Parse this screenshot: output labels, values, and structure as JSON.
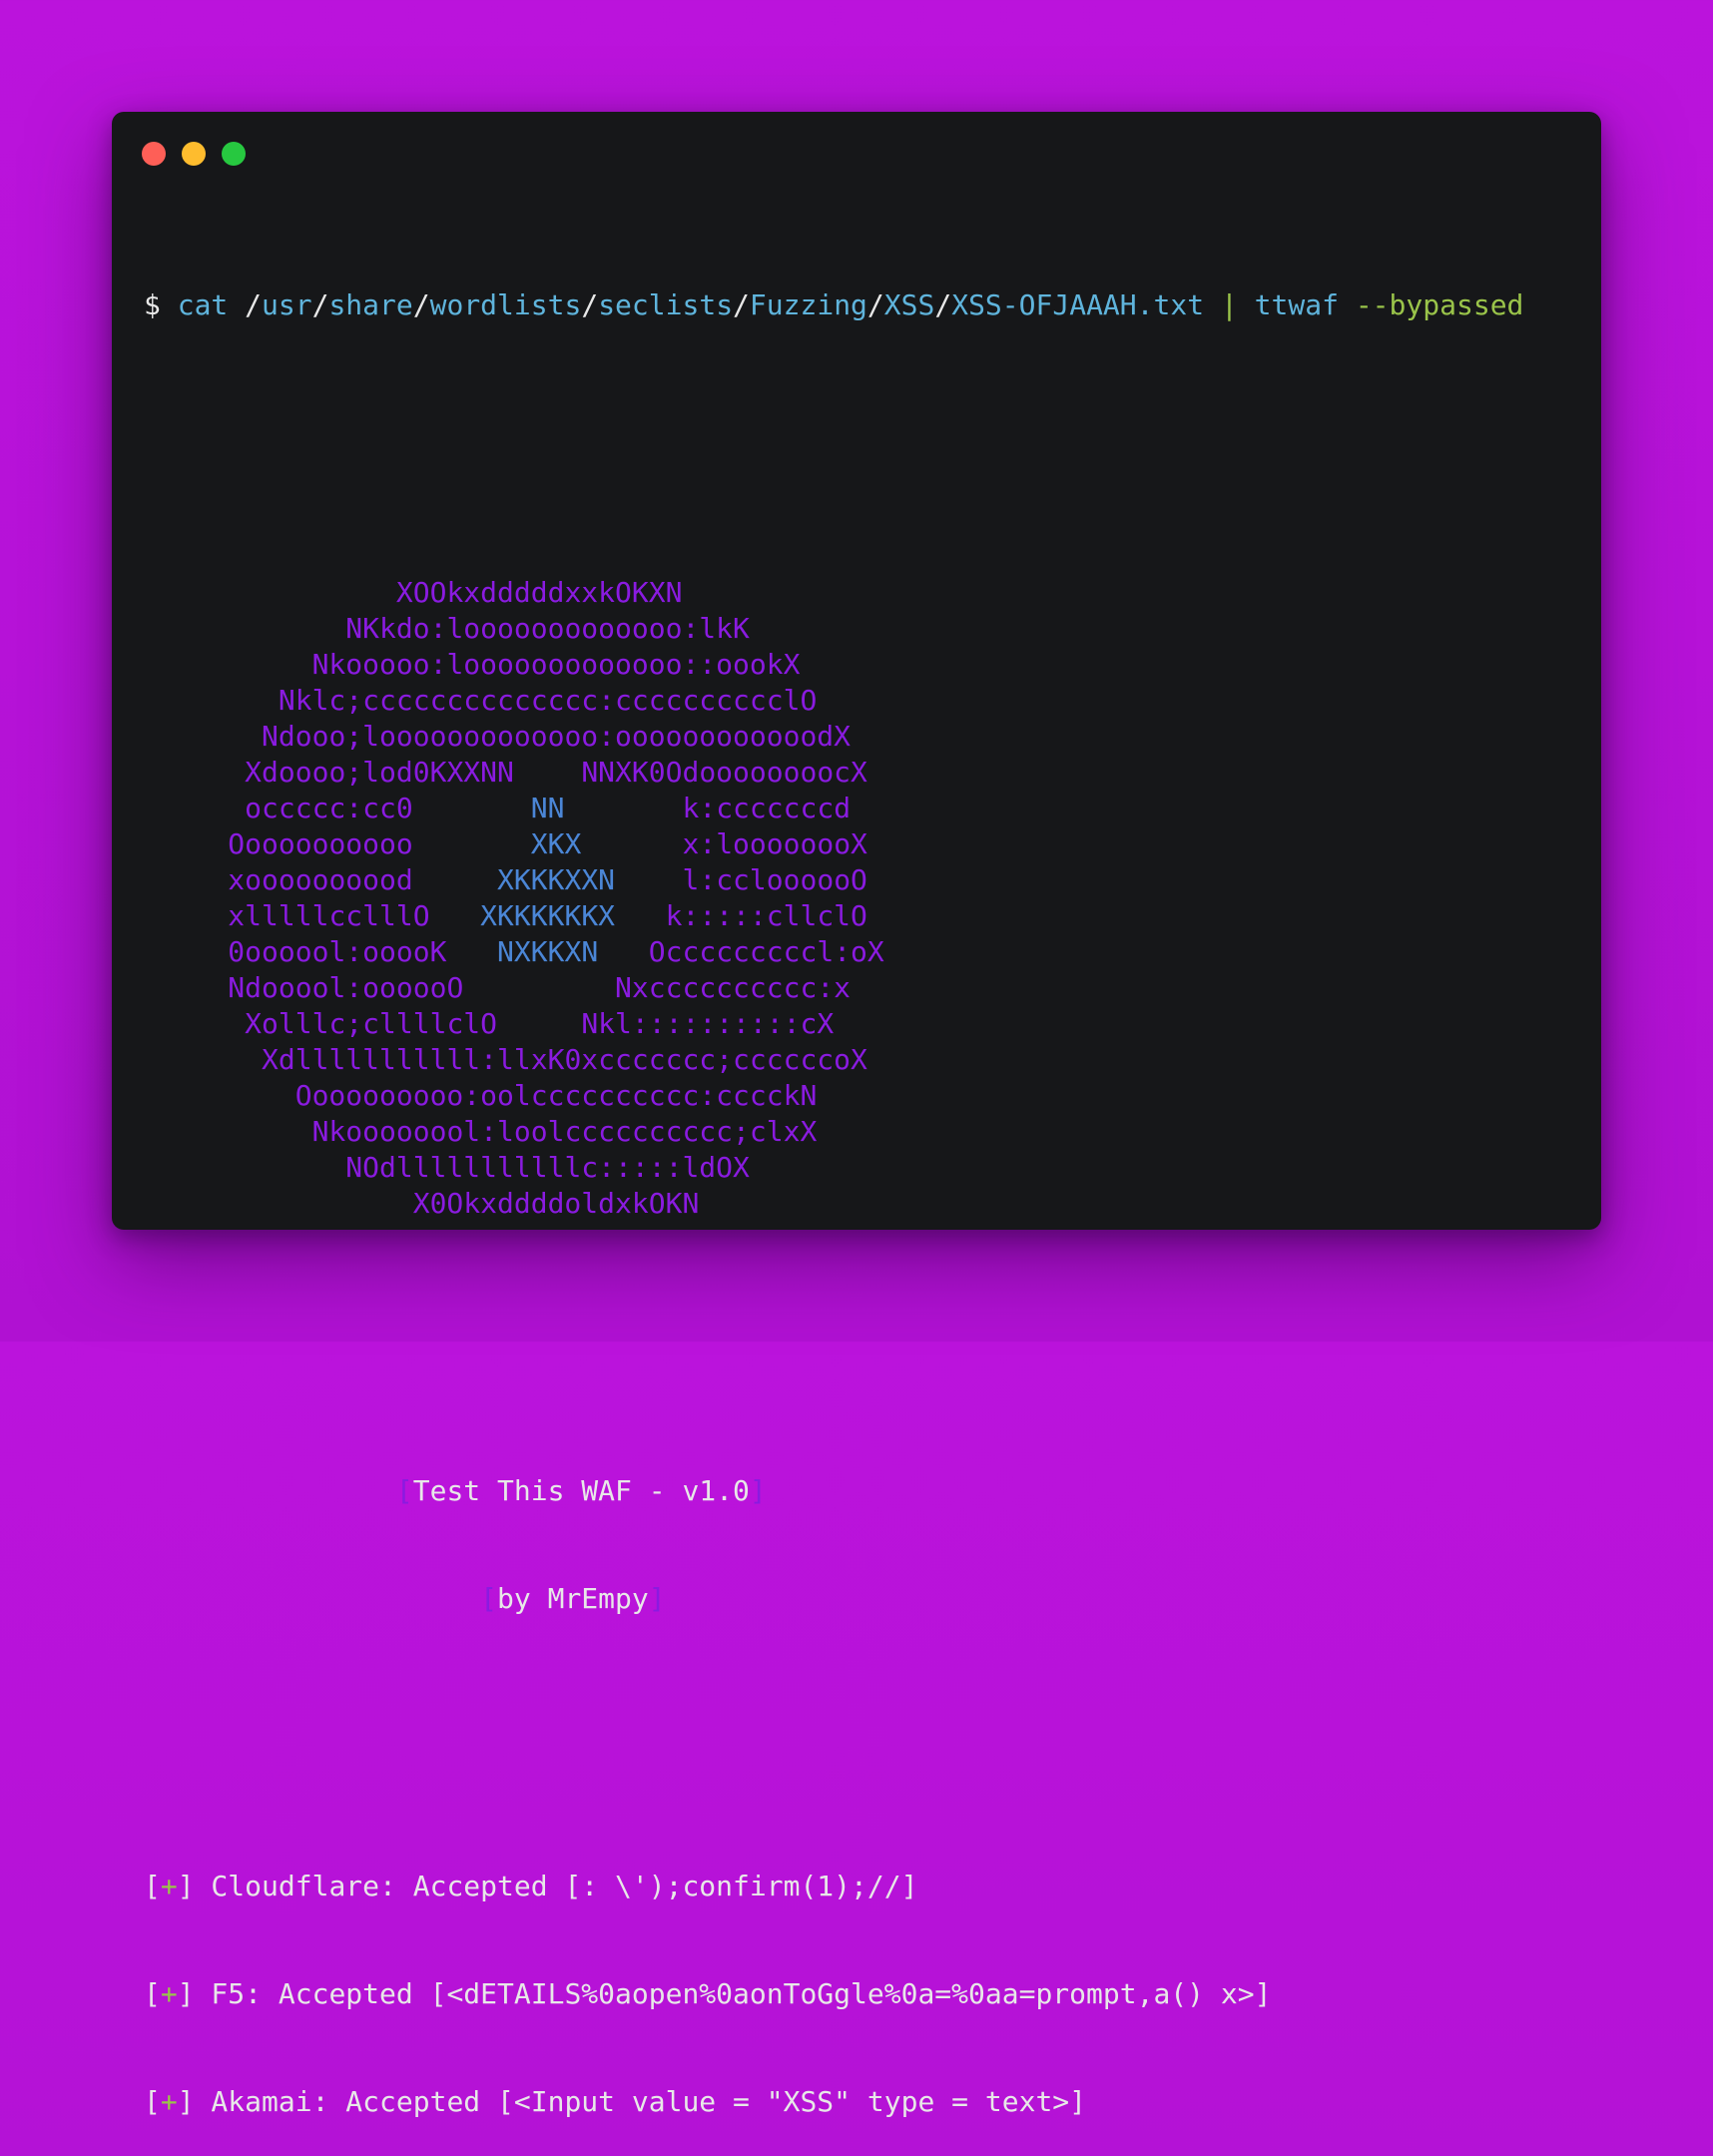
{
  "window_controls": {
    "close_color": "#fe5f57",
    "minimize_color": "#febc2e",
    "maximize_color": "#27c840"
  },
  "command": {
    "prompt": "$",
    "cmd": "cat",
    "path_parts": [
      "usr",
      "share",
      "wordlists",
      "seclists",
      "Fuzzing",
      "XSS",
      "XSS-OFJAAAH.txt"
    ],
    "pipe": "|",
    "tool": "ttwaf",
    "flag": "--bypassed"
  },
  "ascii_art": {
    "purple_color": "#8a1be0",
    "blue_color": "#4b86d6",
    "lines": [
      [
        {
          "indent": 15,
          "text": "XOOkxdddddxxkOKXN",
          "c": "p"
        }
      ],
      [
        {
          "indent": 12,
          "text": "NKkdo:looooooooooooo:lkK",
          "c": "p"
        }
      ],
      [
        {
          "indent": 10,
          "text": "Nkooooo:looooooooooooo::oookX",
          "c": "p"
        }
      ],
      [
        {
          "indent": 8,
          "text": "Nklc;cccccccccccccc:cccccccccclO",
          "c": "p"
        }
      ],
      [
        {
          "indent": 7,
          "text": "Ndooo;looooooooooooo:oooooooooooodX",
          "c": "p"
        }
      ],
      [
        {
          "indent": 6,
          "text": "Xdoooo;lod0KXXNN",
          "c": "p"
        },
        {
          "indent": 4,
          "text": "NNXK0Odoooooooo cX",
          "c": "p"
        }
      ],
      [
        {
          "indent": 6,
          "text": "occccc:cc0",
          "c": "p"
        },
        {
          "indent": 7,
          "text": "NN",
          "c": "b"
        },
        {
          "indent": 7,
          "text": "k:cccccccd",
          "c": "p"
        }
      ],
      [
        {
          "indent": 5,
          "text": "Ooooooooooo",
          "c": "p"
        },
        {
          "indent": 7,
          "text": "XKX",
          "c": "b"
        },
        {
          "indent": 6,
          "text": "x:loooooooX",
          "c": "p"
        }
      ],
      [
        {
          "indent": 5,
          "text": "xoooooooood",
          "c": "p"
        },
        {
          "indent": 5,
          "text": "XKKKXXN",
          "c": "b"
        },
        {
          "indent": 4,
          "text": "l:ccloooooO",
          "c": "p"
        }
      ],
      [
        {
          "indent": 5,
          "text": "xlllllcclllO",
          "c": "p"
        },
        {
          "indent": 3,
          "text": "XKKKKKKX",
          "c": "b"
        },
        {
          "indent": 3,
          "text": "k:::::cllclO",
          "c": "p"
        }
      ],
      [
        {
          "indent": 5,
          "text": "0oooool:ooooK",
          "c": "p"
        },
        {
          "indent": 3,
          "text": "NXKKXN",
          "c": "b"
        },
        {
          "indent": 3,
          "text": "Occcccccccl:oX",
          "c": "p"
        }
      ],
      [
        {
          "indent": 5,
          "text": "Ndooool:oooooO",
          "c": "p"
        },
        {
          "indent": 9,
          "text": "Nxcccccccccc:x",
          "c": "p"
        }
      ],
      [
        {
          "indent": 6,
          "text": "Xolllc;cllllclO",
          "c": "p"
        },
        {
          "indent": 5,
          "text": "Nkl::::::::::cX",
          "c": "p"
        }
      ],
      [
        {
          "indent": 7,
          "text": "Xdlllllllllll:llxK0xccccccc;ccccccoX",
          "c": "p"
        }
      ],
      [
        {
          "indent": 9,
          "text": "Oooooooooo:oolcccccccccc:cccckN",
          "c": "p"
        }
      ],
      [
        {
          "indent": 10,
          "text": "Nkoooooool:loolcccccccccc;clxX",
          "c": "p"
        }
      ],
      [
        {
          "indent": 12,
          "text": "NOdlllllllllllc:::::ldOX",
          "c": "p"
        }
      ],
      [
        {
          "indent": 16,
          "text": "X0OkxddddoldxkOKN",
          "c": "p"
        }
      ]
    ]
  },
  "banner": {
    "title": "Test This WAF - v1.0",
    "author": "by MrEmpy",
    "open_bracket": "[",
    "close_bracket": "]"
  },
  "results": [
    {
      "marker": "+",
      "text": " Cloudflare: Accepted [: \\');confirm(1);//]"
    },
    {
      "marker": "+",
      "text": " F5: Accepted [<dETAILS%0aopen%0aonToGgle%0a=%0aa=prompt,a() x>]"
    },
    {
      "marker": "+",
      "text": " Akamai: Accepted [<Input value = \"XSS\" type = text>]"
    }
  ]
}
